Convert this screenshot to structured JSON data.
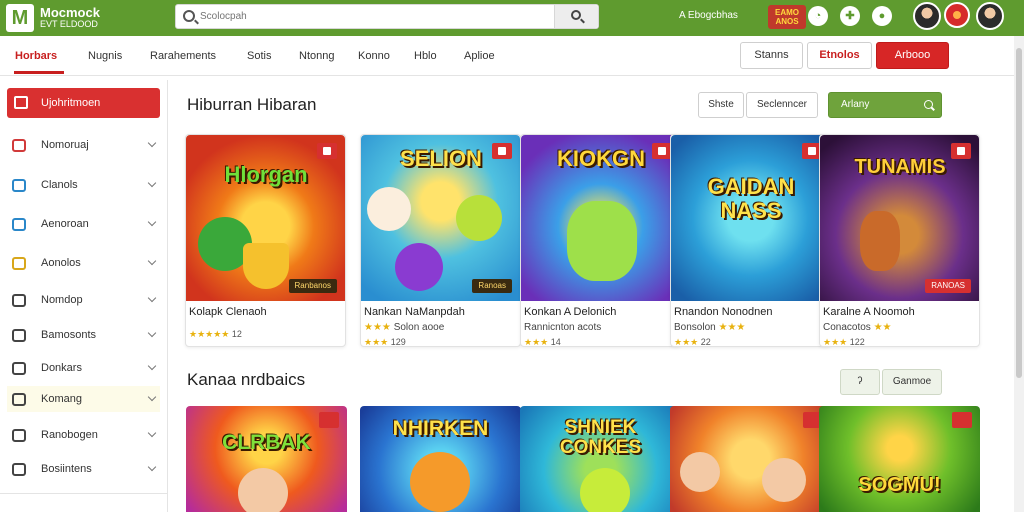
{
  "header": {
    "logo_line1": "Mocmock",
    "logo_line2": "EVT ELDOOD",
    "search_placeholder": "Scolocpah",
    "top_label": "A Ebogcbhas",
    "badge_text": "EAMO ANOS"
  },
  "nav": {
    "items": [
      "Horbars",
      "Nugnis",
      "Rarahements",
      "Sotis",
      "Ntonng",
      "Konno",
      "Hblo",
      "Aplioe"
    ],
    "active_index": 0,
    "buttons": {
      "outline": "Stanns",
      "outline_red": "Etnolos",
      "primary": "Arbooo"
    }
  },
  "sidebar": {
    "active_label": "Ujohritmoen",
    "items": [
      {
        "label": "Nomoruaj",
        "icon": "shield-icon"
      },
      {
        "label": "Clanols",
        "icon": "monitor-icon"
      },
      {
        "label": "Aenoroan",
        "icon": "cart-icon"
      },
      {
        "label": "Aonolos",
        "icon": "ticket-icon"
      },
      {
        "label": "Nomdop",
        "icon": "box-icon"
      },
      {
        "label": "Bamosonts",
        "icon": "notes-icon"
      },
      {
        "label": "Donkars",
        "icon": "shirt-icon"
      },
      {
        "label": "Komang",
        "icon": "grid-icon"
      },
      {
        "label": "Ranobogen",
        "icon": "bag-icon"
      },
      {
        "label": "Bosiintens",
        "icon": "music-icon"
      }
    ]
  },
  "section1": {
    "title": "Hiburran Hibaran",
    "filters": {
      "a": "Shste",
      "b": "Seclenncer",
      "green": "Arlany"
    },
    "cards": [
      {
        "art_title": "Hlorgan",
        "tag": "Ranbanos",
        "name": "Kolapk Clenaoh",
        "sub": "",
        "stars": "★★★★★",
        "rating": "12"
      },
      {
        "art_title": "SELION",
        "tag": "Ranoas",
        "name": "Nankan NaManpdah",
        "sub": "Solon aooe",
        "stars": "★★★",
        "rating": "129"
      },
      {
        "art_title": "KIOKGN",
        "tag": "",
        "name": "Konkan A Delonich",
        "sub": "Rannicnton acots",
        "stars": "★★★",
        "rating": "14"
      },
      {
        "art_title": "GAIDAN NASS",
        "tag": "",
        "name": "Rnandon Nonodnen",
        "sub": "Bonsolon",
        "stars": "★★★",
        "rating": "22"
      },
      {
        "art_title": "TUNAMIS",
        "tag": "RANOAS",
        "name": "Karalne A Noomoh",
        "sub": "Conacotos",
        "stars": "★★★",
        "rating": "122"
      }
    ]
  },
  "section2": {
    "title": "Kanaa nrdbaics",
    "filter_left": "ʔ",
    "filter_right": "Ganmoe",
    "cards": [
      {
        "art_title": "CLRBAK"
      },
      {
        "art_title": "NHIRKEN"
      },
      {
        "art_title": "SHNIEK CONKES"
      },
      {
        "art_title": ""
      },
      {
        "art_title": "SOGMU!"
      }
    ]
  },
  "colors": {
    "topbar": "#5f9b2f",
    "accent_red": "#d72626",
    "star": "#e8b20f",
    "green_button": "#6fa33c"
  }
}
